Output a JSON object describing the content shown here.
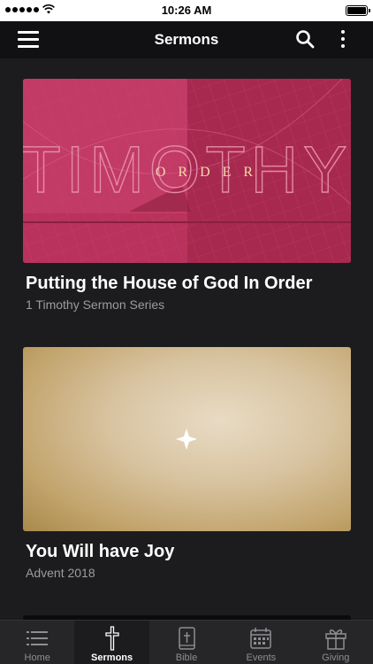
{
  "status_bar": {
    "time": "10:26 AM"
  },
  "header": {
    "title": "Sermons"
  },
  "sermons": [
    {
      "title": "Putting the House of God In Order",
      "subtitle": "1 Timothy Sermon Series",
      "art_text": "TIMOTHY",
      "art_overlay": "ORDER"
    },
    {
      "title": "You Will have Joy",
      "subtitle": "Advent 2018"
    }
  ],
  "tabs": [
    {
      "label": "Home",
      "icon": "list-icon"
    },
    {
      "label": "Sermons",
      "icon": "cross-icon",
      "active": true
    },
    {
      "label": "Bible",
      "icon": "bible-icon"
    },
    {
      "label": "Events",
      "icon": "calendar-icon"
    },
    {
      "label": "Giving",
      "icon": "gift-icon"
    }
  ],
  "colors": {
    "accent_pink": "#b8325d",
    "background": "#1c1c1e",
    "nav": "#111113"
  }
}
